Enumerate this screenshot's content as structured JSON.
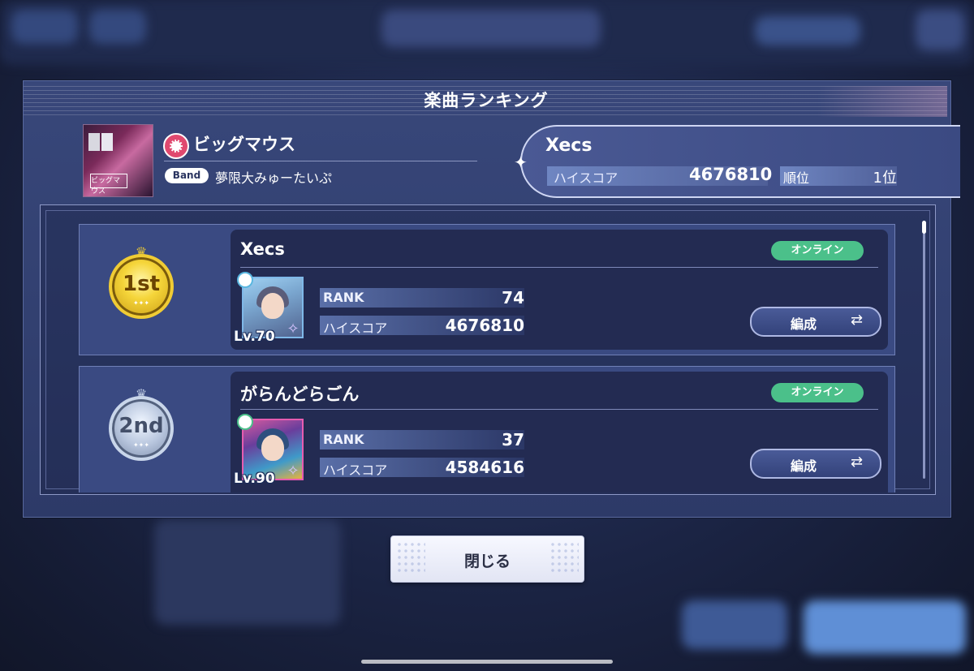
{
  "dialog": {
    "title": "楽曲ランキング",
    "song": {
      "title": "ビッグマウス",
      "unit_badge": "Band",
      "artist": "夢限大みゅーたいぷ",
      "jacket_text_top": "123/4x",
      "jacket_text": "ビッグマウス"
    },
    "my_record": {
      "name": "Xecs",
      "score_label": "ハイスコア",
      "score": "4676810",
      "rank_label": "順位",
      "rank": "1位"
    },
    "rankings": [
      {
        "place": "1st",
        "name": "Xecs",
        "status": "オンライン",
        "level": "Lv.70",
        "rank_label": "RANK",
        "rank": "74",
        "score_label": "ハイスコア",
        "score": "4676810",
        "formation_label": "編成"
      },
      {
        "place": "2nd",
        "name": "がらんどらごん",
        "status": "オンライン",
        "level": "Lv.90",
        "rank_label": "RANK",
        "rank": "37",
        "score_label": "ハイスコア",
        "score": "4584616",
        "formation_label": "編成"
      }
    ],
    "close_label": "閉じる"
  },
  "icons": {
    "sparkle": "✦",
    "crown": "♛",
    "stars": "✦✦✦",
    "star_badge": "✧",
    "swap": "⇄"
  },
  "colors": {
    "online": "#4bc08a",
    "gold": "#f0cc34",
    "silver": "#c9d6ea",
    "unit": "#e0496f"
  }
}
